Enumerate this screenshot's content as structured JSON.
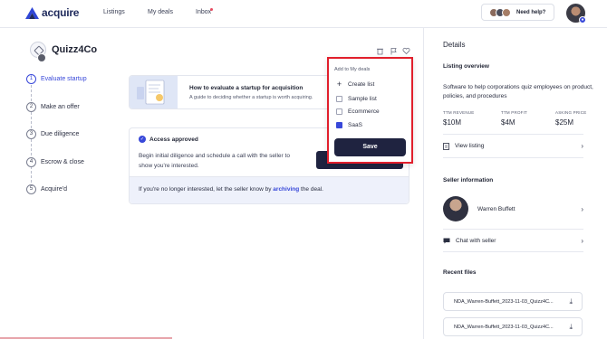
{
  "nav": {
    "brand": "acquire",
    "links": [
      "Listings",
      "My deals",
      "Inbox"
    ],
    "help_label": "Need help?"
  },
  "company": {
    "name": "Quizz4Co"
  },
  "steps": [
    {
      "num": "1",
      "label": "Evaluate startup"
    },
    {
      "num": "2",
      "label": "Make an offer"
    },
    {
      "num": "3",
      "label": "Due diligence"
    },
    {
      "num": "4",
      "label": "Escrow & close"
    },
    {
      "num": "5",
      "label": "Acquire'd"
    }
  ],
  "guide": {
    "title": "How to evaluate a startup for acquisition",
    "subtitle": "A guide to deciding whether a startup is worth acquiring."
  },
  "access": {
    "title": "Access approved",
    "text": "Begin initial diligence and schedule a call with the seller to show you're interested.",
    "archive_prefix": "If you're no longer interested, let the seller know by ",
    "archive_link": "archiving",
    "archive_suffix": " the deal."
  },
  "dropdown": {
    "header": "Add to My deals",
    "create_label": "Create list",
    "lists": [
      {
        "label": "Sample list",
        "checked": false
      },
      {
        "label": "Ecommerce",
        "checked": false
      },
      {
        "label": "SaaS",
        "checked": true
      }
    ],
    "save_label": "Save"
  },
  "sidebar": {
    "title": "Details",
    "overview_heading": "Listing overview",
    "description": "Software to help corporations quiz employees on product, policies, and procedures",
    "metrics": [
      {
        "label": "TTM REVENUE",
        "value": "$10M"
      },
      {
        "label": "TTM PROFIT",
        "value": "$4M"
      },
      {
        "label": "ASKING PRICE",
        "value": "$25M"
      }
    ],
    "view_listing": "View listing",
    "seller_heading": "Seller information",
    "seller_name": "Warren Buffett",
    "chat_label": "Chat with seller",
    "files_heading": "Recent files",
    "files": [
      "NDA_Warren-Buffett_2023-11-03_Quizz4C...",
      "NDA_Warren-Buffett_2023-11-03_Quizz4C..."
    ]
  },
  "colors": {
    "accent": "#3848d9",
    "dark_button": "#1f2340",
    "highlight_border": "#e11f2c"
  },
  "icons": [
    "acquire-logo-icon",
    "trash-icon",
    "flag-icon",
    "heart-icon",
    "check-circle-icon",
    "plus-icon",
    "document-icon",
    "chat-icon",
    "chevron-right-icon",
    "download-icon"
  ]
}
